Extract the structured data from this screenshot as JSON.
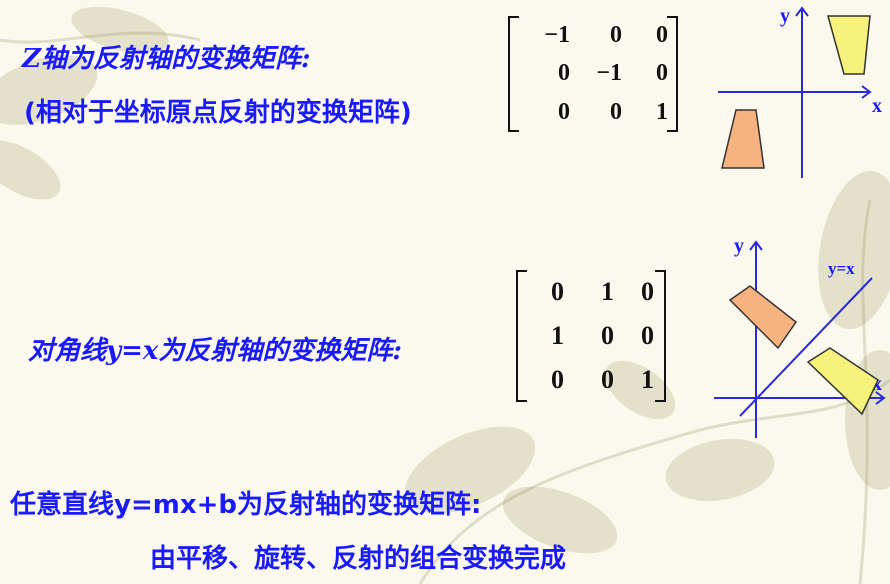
{
  "section1": {
    "title": "Z轴为反射轴的变换矩阵:",
    "subtitle": "(相对于坐标原点反射的变换矩阵)",
    "matrix": [
      [
        "−1",
        "0",
        "0"
      ],
      [
        "0",
        "−1",
        "0"
      ],
      [
        "0",
        "0",
        "1"
      ]
    ]
  },
  "section2": {
    "title": "对角线y=x为反射轴的变换矩阵:",
    "matrix": [
      [
        "0",
        "1",
        "0"
      ],
      [
        "1",
        "0",
        "0"
      ],
      [
        "0",
        "0",
        "1"
      ]
    ],
    "diagonal_label": "y=x"
  },
  "section3": {
    "title": "任意直线y=mx+b为反射轴的变换矩阵:",
    "note": "由平移、旋转、反射的组合变换完成"
  },
  "axes": {
    "x": "x",
    "y": "y"
  },
  "colors": {
    "text": "#1a1aff",
    "axis": "#2a2ad8",
    "shape_yellow": "#f7f27c",
    "shape_orange": "#f6b27f"
  }
}
